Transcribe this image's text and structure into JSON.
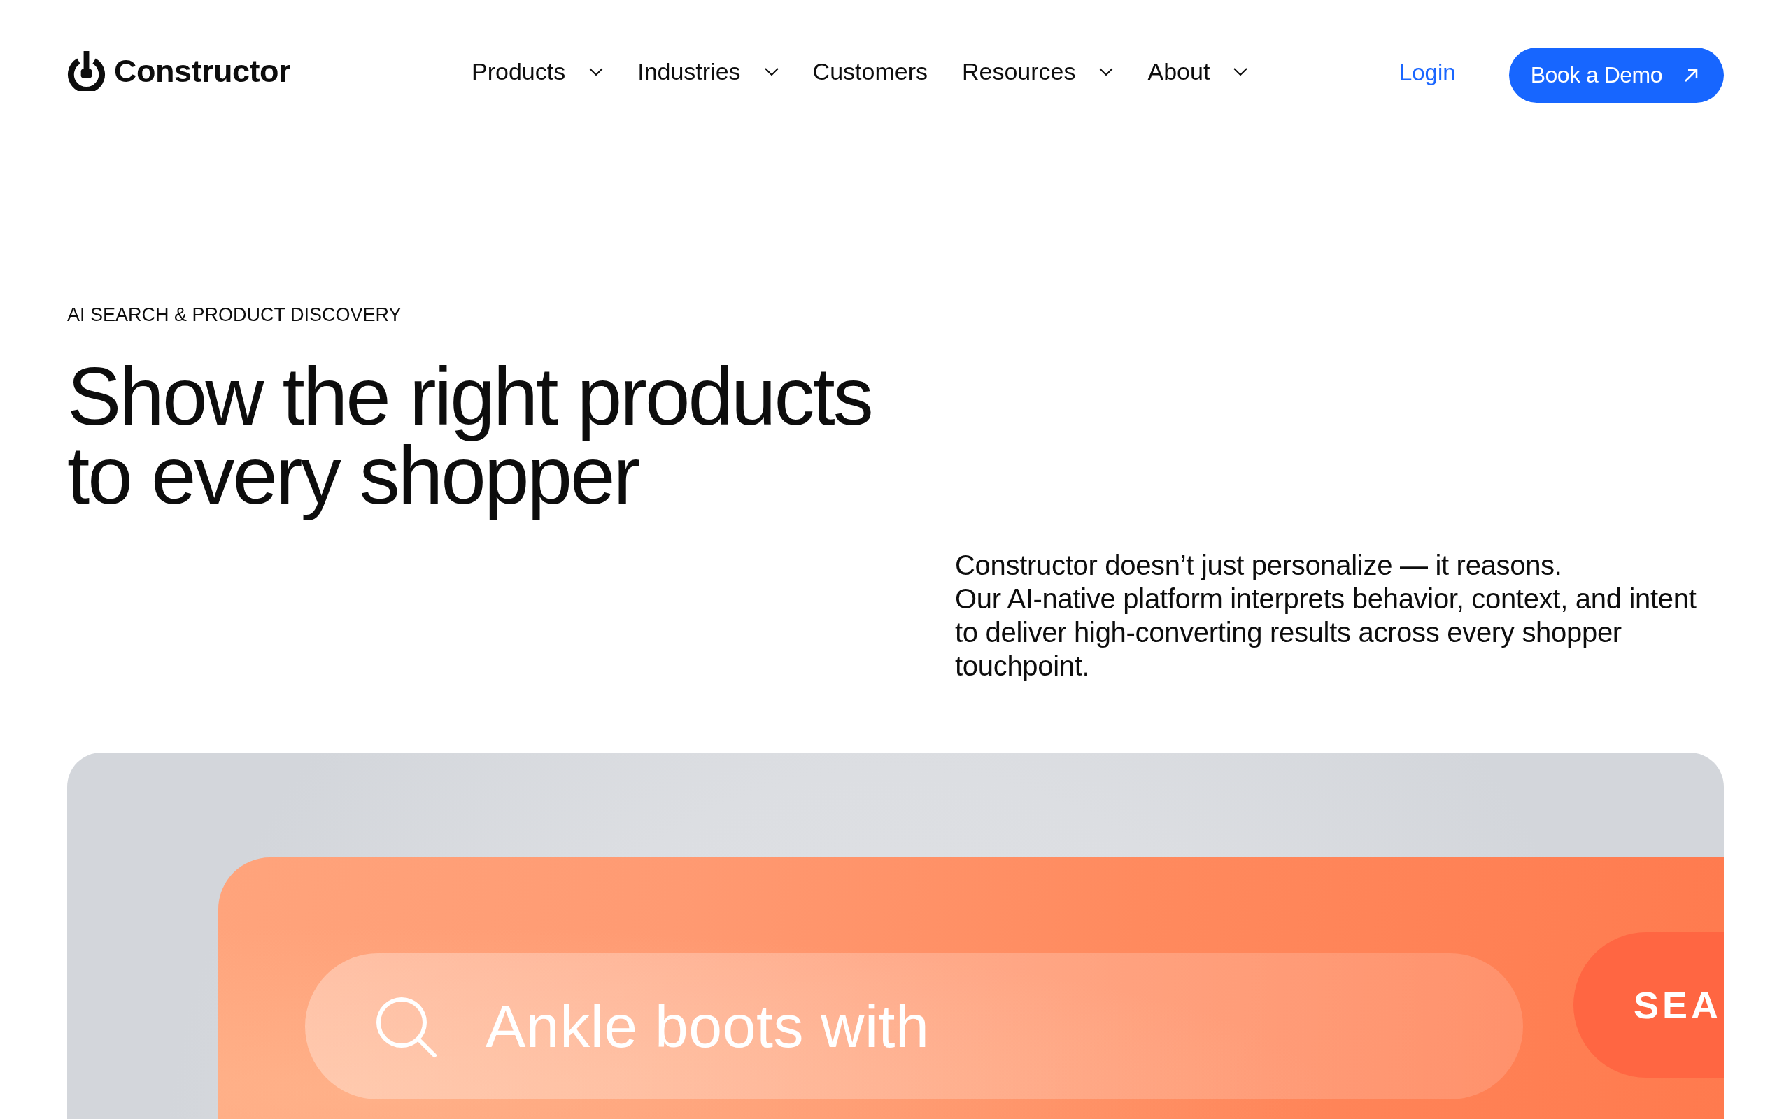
{
  "header": {
    "logo": {
      "text": "Constructor"
    },
    "nav": [
      {
        "label": "Products",
        "kind": "dropdown"
      },
      {
        "label": "Industries",
        "kind": "dropdown"
      },
      {
        "label": "Customers",
        "kind": "link"
      },
      {
        "label": "Resources",
        "kind": "dropdown"
      },
      {
        "label": "About",
        "kind": "dropdown"
      }
    ],
    "login": "Login",
    "cta": "Book a Demo"
  },
  "hero": {
    "eyebrow": "AI SEARCH & PRODUCT DISCOVERY",
    "headline": [
      "Show the right products",
      "to every shopper"
    ],
    "description": [
      "Constructor doesn’t just personalize — it reasons.",
      "Our AI-native platform interprets behavior, context, and intent to deliver high-converting results across every shopper touchpoint."
    ]
  },
  "demo": {
    "search": {
      "value": "Ankle boots with"
    },
    "search_button": "SEA"
  }
}
